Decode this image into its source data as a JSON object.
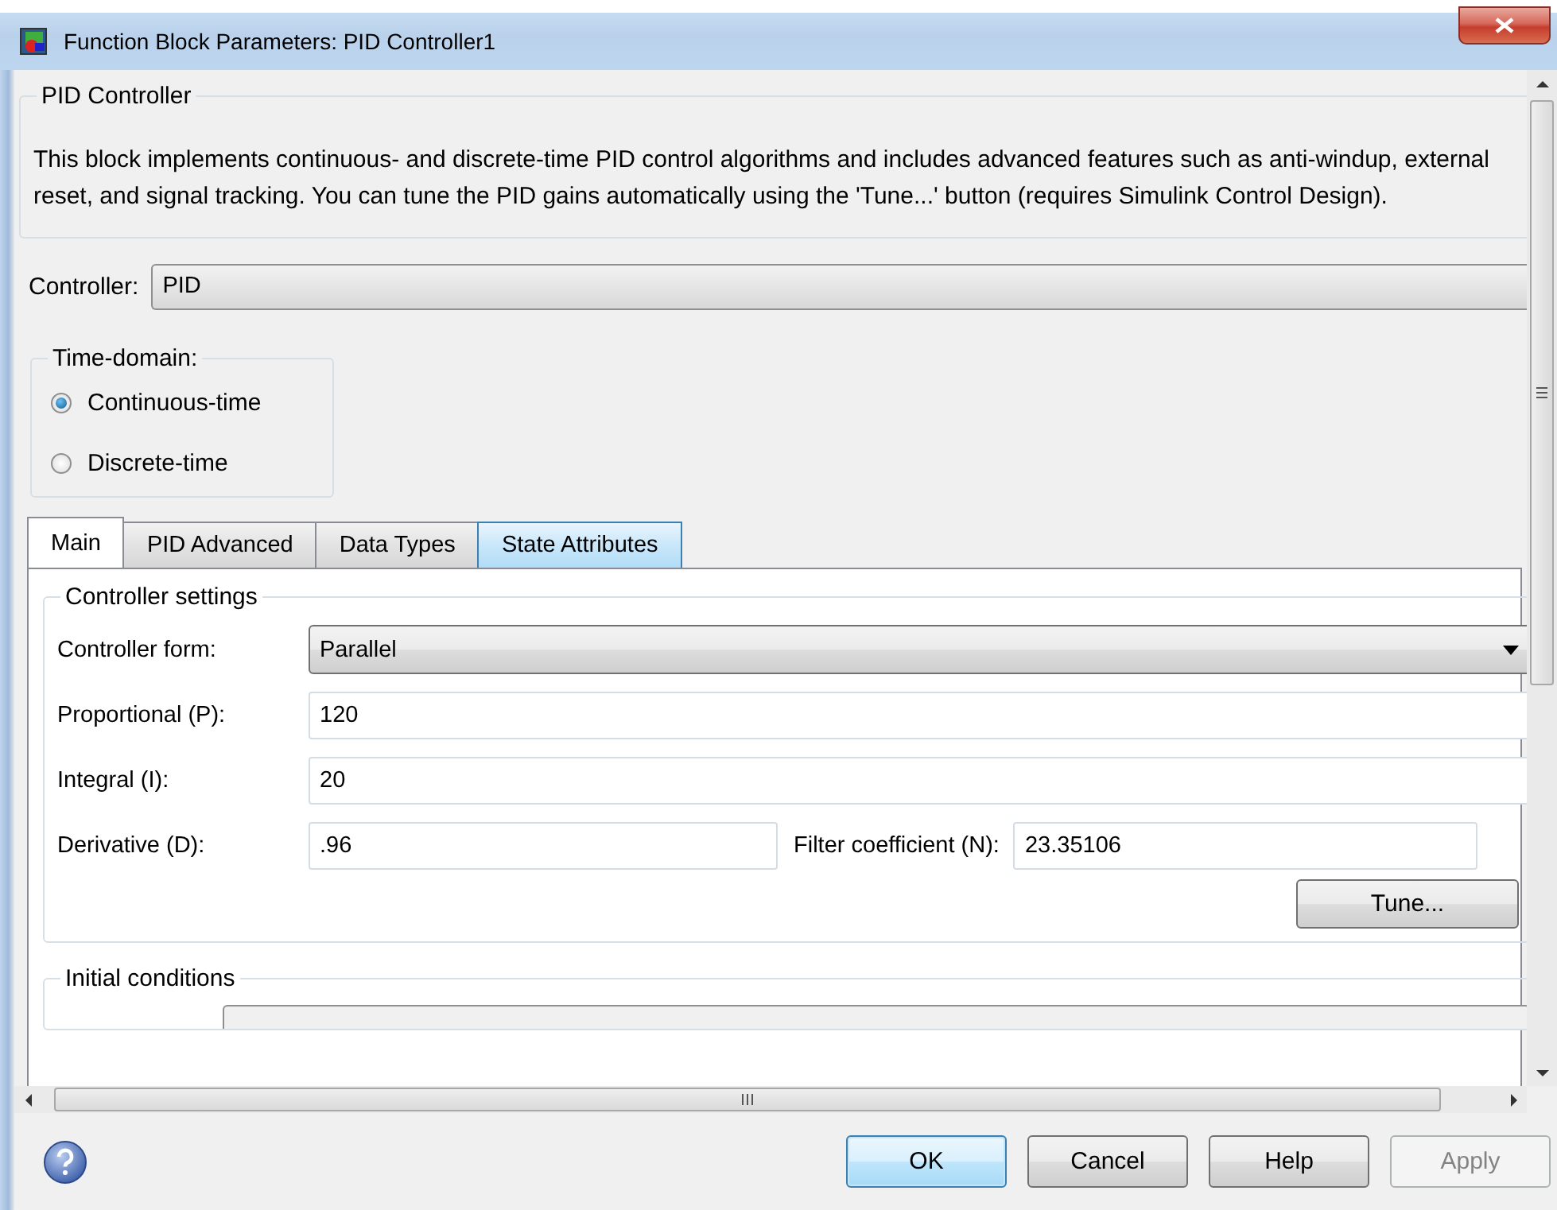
{
  "window": {
    "title": "Function Block Parameters: PID Controller1"
  },
  "description_group": {
    "title": "PID Controller",
    "text": "This block implements continuous- and discrete-time PID control algorithms and includes advanced features such as anti-windup, external reset, and signal tracking. You can tune the PID gains automatically using the 'Tune...' button (requires Simulink Control Design)."
  },
  "controller": {
    "label": "Controller:",
    "value": "PID"
  },
  "time_domain": {
    "title": "Time-domain:",
    "options": [
      {
        "label": "Continuous-time",
        "selected": true
      },
      {
        "label": "Discrete-time",
        "selected": false
      }
    ]
  },
  "tabs": [
    {
      "label": "Main",
      "selected": true,
      "hovered": false
    },
    {
      "label": "PID Advanced",
      "selected": false,
      "hovered": false
    },
    {
      "label": "Data Types",
      "selected": false,
      "hovered": false
    },
    {
      "label": "State Attributes",
      "selected": false,
      "hovered": true
    }
  ],
  "controller_settings": {
    "title": "Controller settings",
    "fields": [
      {
        "kind": "dropdown",
        "label": "Controller form:",
        "value": "Parallel"
      },
      {
        "kind": "input",
        "label": "Proportional (P):",
        "value": "120"
      },
      {
        "kind": "input",
        "label": "Integral (I):",
        "value": "20"
      },
      {
        "kind": "pair",
        "label": "Derivative (D):",
        "value": ".96",
        "label_2": "Filter coefficient (N):",
        "value_2": "23.35106"
      }
    ],
    "tune_button": "Tune..."
  },
  "initial_conditions": {
    "title": "Initial conditions"
  },
  "buttons": [
    {
      "label": "OK",
      "focused": true,
      "disabled": false
    },
    {
      "label": "Cancel",
      "focused": false,
      "disabled": false
    },
    {
      "label": "Help",
      "focused": false,
      "disabled": false
    },
    {
      "label": "Apply",
      "focused": false,
      "disabled": true
    }
  ]
}
